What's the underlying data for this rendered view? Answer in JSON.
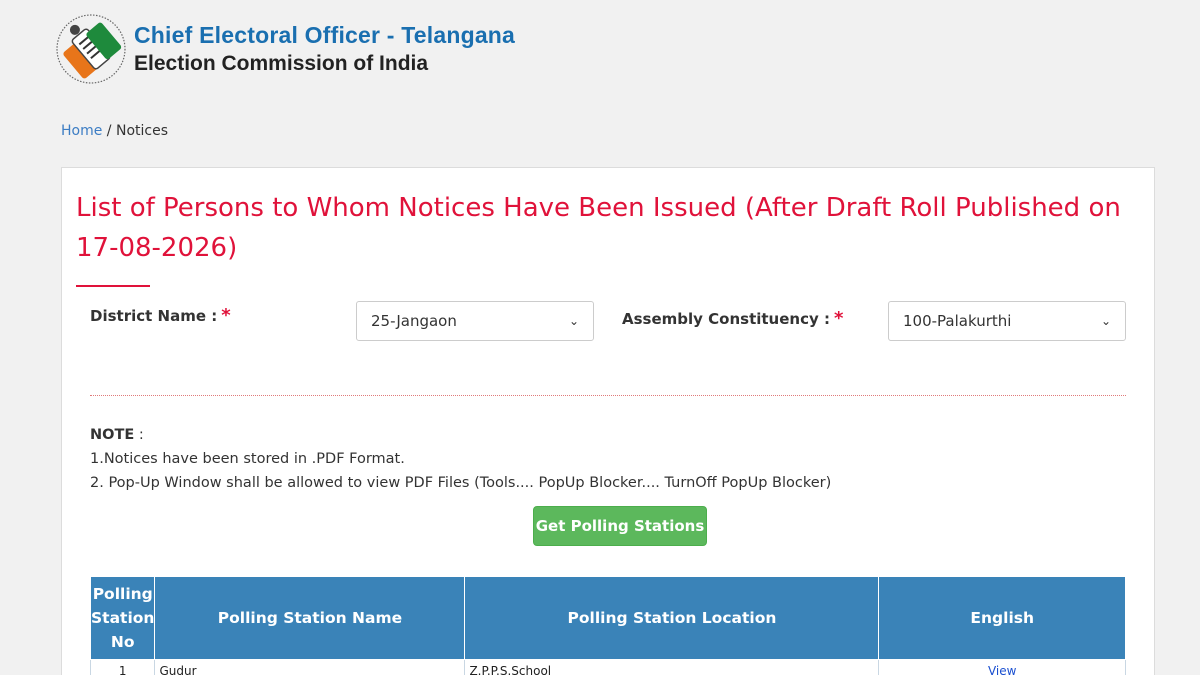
{
  "brand": {
    "title": "Chief Electoral Officer - Telangana",
    "subtitle": "Election Commission of India"
  },
  "breadcrumb": {
    "home": "Home",
    "separator": " / ",
    "current": "Notices"
  },
  "page": {
    "title": "List of Persons to Whom Notices Have Been Issued (After Draft Roll Published on 17-08-2026)"
  },
  "filters": {
    "district": {
      "label": "District Name :",
      "required": "*",
      "value": "25-Jangaon"
    },
    "assembly": {
      "label": "Assembly Constituency :",
      "required": "*",
      "value": "100-Palakurthi"
    }
  },
  "note": {
    "heading": "NOTE",
    "colon": " :",
    "line1": "1.Notices have been stored in .PDF Format.",
    "line2": "2. Pop-Up Window shall be allowed to view PDF Files (Tools.... PopUp Blocker.... TurnOff PopUp Blocker)"
  },
  "action": {
    "get_stations": "Get Polling Stations"
  },
  "table": {
    "headers": {
      "no_line1": "Polling",
      "no_line2": "Station",
      "no_line3": "No",
      "name": "Polling Station Name",
      "location": "Polling Station Location",
      "english": "English"
    },
    "rows": [
      {
        "no": "1",
        "name": "Gudur",
        "location": "Z.P.P.S.School",
        "link": "View"
      }
    ]
  },
  "colors": {
    "brand_blue": "#1a6fb0",
    "title_red": "#e0123a",
    "header_blue": "#3a83b8",
    "button_green": "#5cb85c"
  }
}
